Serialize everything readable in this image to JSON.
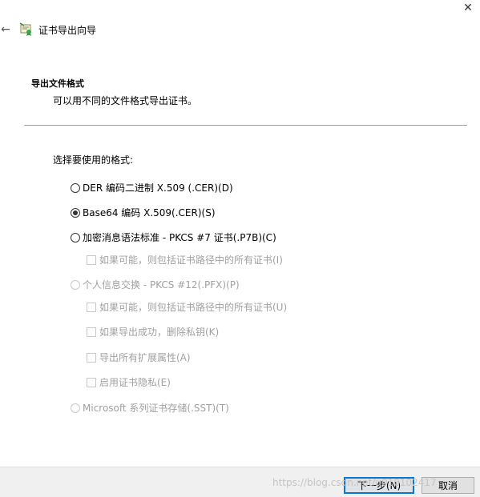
{
  "window": {
    "title": "证书导出向导",
    "close_glyph": "✕",
    "back_glyph": "←"
  },
  "section": {
    "heading": "导出文件格式",
    "description": "可以用不同的文件格式导出证书。",
    "prompt": "选择要使用的格式:"
  },
  "options": {
    "der": {
      "label": "DER 编码二进制 X.509 (.CER)(D)",
      "checked": false,
      "enabled": true
    },
    "base64": {
      "label": "Base64 编码 X.509(.CER)(S)",
      "checked": true,
      "enabled": true
    },
    "pkcs7": {
      "label": "加密消息语法标准 - PKCS #7 证书(.P7B)(C)",
      "checked": false,
      "enabled": true
    },
    "pkcs7_include_all": {
      "label": "如果可能，则包括证书路径中的所有证书(I)",
      "checked": false,
      "enabled": false
    },
    "pkcs12": {
      "label": "个人信息交换 - PKCS #12(.PFX)(P)",
      "checked": false,
      "enabled": false
    },
    "pkcs12_include_all": {
      "label": "如果可能，则包括证书路径中的所有证书(U)",
      "checked": false,
      "enabled": false
    },
    "pkcs12_delete_key": {
      "label": "如果导出成功，删除私钥(K)",
      "checked": false,
      "enabled": false
    },
    "pkcs12_export_props": {
      "label": "导出所有扩展属性(A)",
      "checked": false,
      "enabled": false
    },
    "pkcs12_privacy": {
      "label": "启用证书隐私(E)",
      "checked": false,
      "enabled": false
    },
    "sst": {
      "label": "Microsoft 系列证书存储(.SST)(T)",
      "checked": false,
      "enabled": false
    }
  },
  "footer": {
    "next_label": "下一步(N)",
    "cancel_label": "取消",
    "watermark": "https://blog.csdn.net/u010102417"
  },
  "colors": {
    "accent": "#0078d7",
    "disabled_text": "#a0a0a0",
    "footer_bg": "#f0f0f0"
  }
}
